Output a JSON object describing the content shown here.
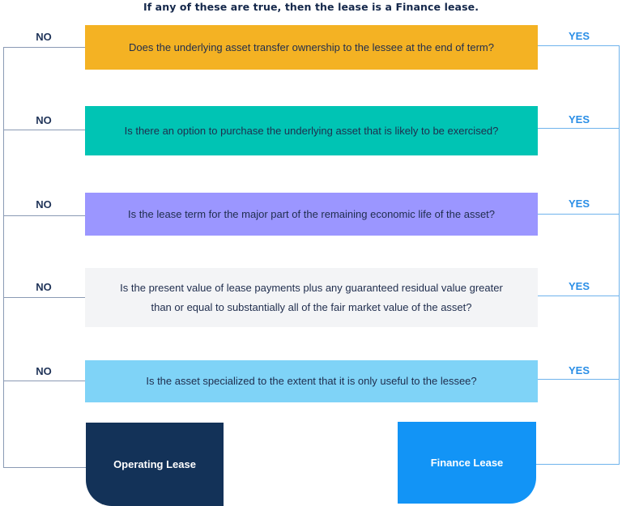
{
  "title": "If any of these are true, then the lease is a Finance lease.",
  "branch_labels": {
    "no": "NO",
    "yes": "YES"
  },
  "questions": [
    {
      "text": "Does the underlying asset transfer ownership to the lessee at the end of term?",
      "color": "#F4B223"
    },
    {
      "text": "Is there an option to purchase the underlying asset that is likely to be exercised?",
      "color": "#00C4B4"
    },
    {
      "text": "Is the lease term for the major part of the remaining economic life of the asset?",
      "color": "#9B96FF"
    },
    {
      "text_line1": "Is the present value of lease payments plus any guaranteed residual value greater",
      "text_line2": "than or equal to substantially all of the fair market value of the asset?",
      "color": "#F3F4F6"
    },
    {
      "text": "Is the asset specialized to the extent that it is only useful to the lessee?",
      "color": "#7FD3F7"
    }
  ],
  "outcomes": {
    "no_result": {
      "label": "Operating Lease",
      "color": "#133258"
    },
    "yes_result": {
      "label": "Finance Lease",
      "color": "#1294F6"
    }
  },
  "line_colors": {
    "no": "#8A9AB4",
    "yes": "#6FB3EC"
  }
}
